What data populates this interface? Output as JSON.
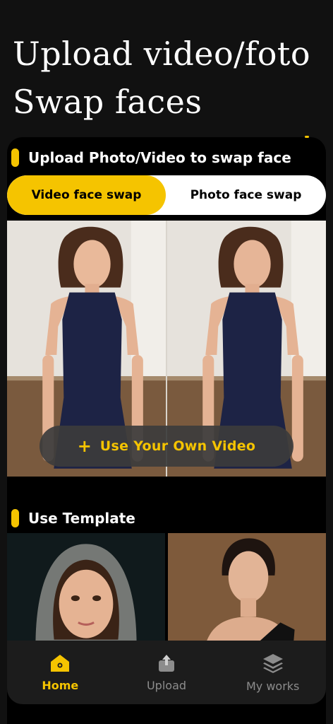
{
  "hero": {
    "line1": "Upload video/foto",
    "line2": "Swap faces"
  },
  "upload_section": {
    "title": "Upload Photo/Video to swap face",
    "tabs": [
      {
        "label": "Video face swap",
        "active": true
      },
      {
        "label": "Photo face swap",
        "active": false
      }
    ],
    "action_plus": "+",
    "action_label": "Use Your Own Video"
  },
  "template_section": {
    "title": "Use Template"
  },
  "tabbar": {
    "items": [
      {
        "label": "Home",
        "icon": "home-icon",
        "active": true
      },
      {
        "label": "Upload",
        "icon": "upload-icon",
        "active": false
      },
      {
        "label": "My works",
        "icon": "layers-icon",
        "active": false
      }
    ]
  },
  "colors": {
    "accent": "#f5c400",
    "background": "#111111",
    "card": "#000000",
    "tabbar": "#1c1c1c",
    "inactive": "#8c8c8c"
  }
}
